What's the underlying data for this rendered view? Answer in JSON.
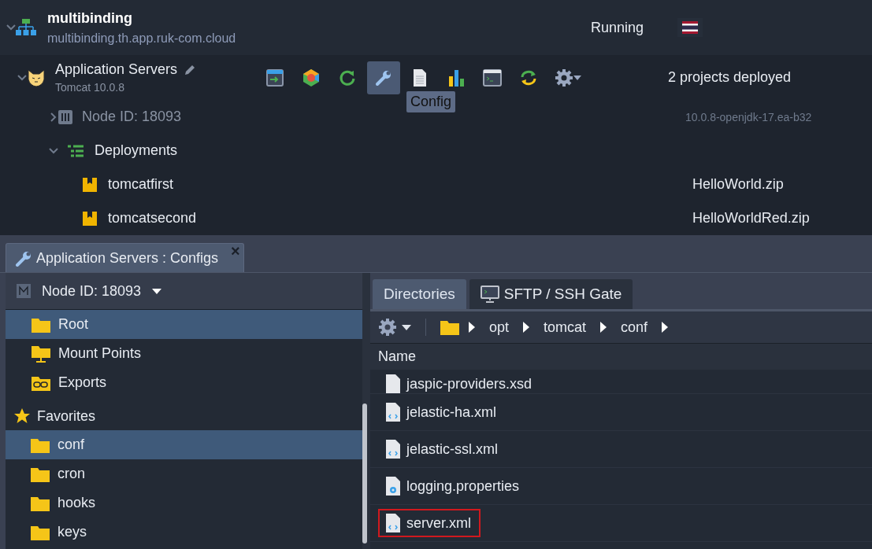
{
  "environment": {
    "name": "multibinding",
    "domain": "multibinding.th.app.ruk-com.cloud",
    "status": "Running",
    "expanded": true
  },
  "node_group": {
    "name": "Application Servers",
    "version": "Tomcat 10.0.8",
    "expanded": true,
    "summary": "2 projects deployed",
    "tooltip": "Config",
    "toolbar": [
      {
        "kind": "open",
        "selected": false
      },
      {
        "kind": "topology",
        "selected": false
      },
      {
        "kind": "restart",
        "selected": false
      },
      {
        "kind": "config",
        "selected": true
      },
      {
        "kind": "log",
        "selected": false
      },
      {
        "kind": "stats",
        "selected": false
      },
      {
        "kind": "terminal",
        "selected": false
      },
      {
        "kind": "redeploy",
        "selected": false
      },
      {
        "kind": "settings",
        "selected": false
      }
    ]
  },
  "node": {
    "label": "Node ID: 18093",
    "version": "10.0.8-openjdk-17.ea-b32",
    "expanded": false
  },
  "deployments": {
    "label": "Deployments",
    "expanded": true,
    "items": [
      {
        "name": "tomcatfirst",
        "archive": "HelloWorld.zip"
      },
      {
        "name": "tomcatsecond",
        "archive": "HelloWorldRed.zip"
      }
    ]
  },
  "config_tab": {
    "title": "Application Servers : Configs",
    "close": "×"
  },
  "sidebar": {
    "node_selector": "Node ID: 18093",
    "items": [
      {
        "label": "Root",
        "kind": "folder",
        "selected": true
      },
      {
        "label": "Mount Points",
        "kind": "mount",
        "selected": false
      },
      {
        "label": "Exports",
        "kind": "export",
        "selected": false
      }
    ],
    "favorites": {
      "label": "Favorites",
      "items": [
        {
          "label": "conf",
          "selected": true
        },
        {
          "label": "cron",
          "selected": false
        },
        {
          "label": "hooks",
          "selected": false
        },
        {
          "label": "keys",
          "selected": false
        }
      ]
    }
  },
  "browser": {
    "tabs": [
      {
        "label": "Directories",
        "kind": "plain",
        "selected": true
      },
      {
        "label": "SFTP / SSH Gate",
        "kind": "terminal",
        "selected": false
      }
    ],
    "breadcrumb": [
      "opt",
      "tomcat",
      "conf"
    ],
    "column": "Name",
    "files": [
      {
        "name": "jaspic-providers.xsd",
        "kind": "plain",
        "highlighted": false
      },
      {
        "name": "jelastic-ha.xml",
        "kind": "xml",
        "highlighted": false
      },
      {
        "name": "jelastic-ssl.xml",
        "kind": "xml",
        "highlighted": false
      },
      {
        "name": "logging.properties",
        "kind": "properties",
        "highlighted": false
      },
      {
        "name": "server.xml",
        "kind": "xml",
        "highlighted": true
      }
    ]
  }
}
